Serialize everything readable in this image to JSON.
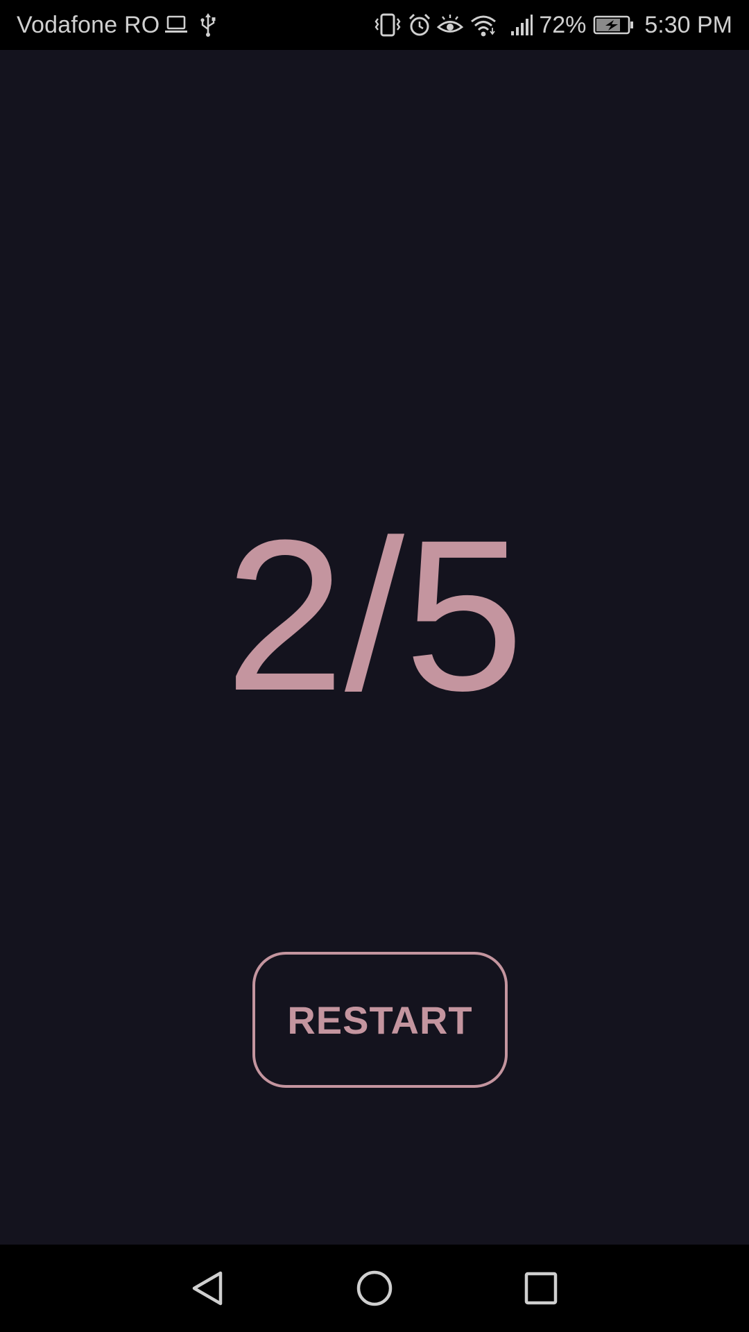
{
  "status_bar": {
    "carrier": "Vodafone RO",
    "left_icons": [
      "laptop-icon",
      "usb-icon"
    ],
    "right_icons": [
      "vibrate-icon",
      "alarm-icon",
      "eye-comfort-icon",
      "wifi-icon",
      "signal-icon"
    ],
    "battery_percent": "72%",
    "battery_icon": "battery-charging-icon",
    "time": "5:30 PM"
  },
  "main": {
    "score": "2/5",
    "restart_label": "RESTART"
  },
  "nav_bar": {
    "buttons": [
      "back-icon",
      "home-icon",
      "recents-icon"
    ]
  },
  "colors": {
    "status_bar_bg": "#000000",
    "status_text": "#d0d0d0",
    "background": "#14131e",
    "accent": "#c4959f",
    "nav_bar_bg": "#000000",
    "nav_icon": "#cfcfcf"
  }
}
